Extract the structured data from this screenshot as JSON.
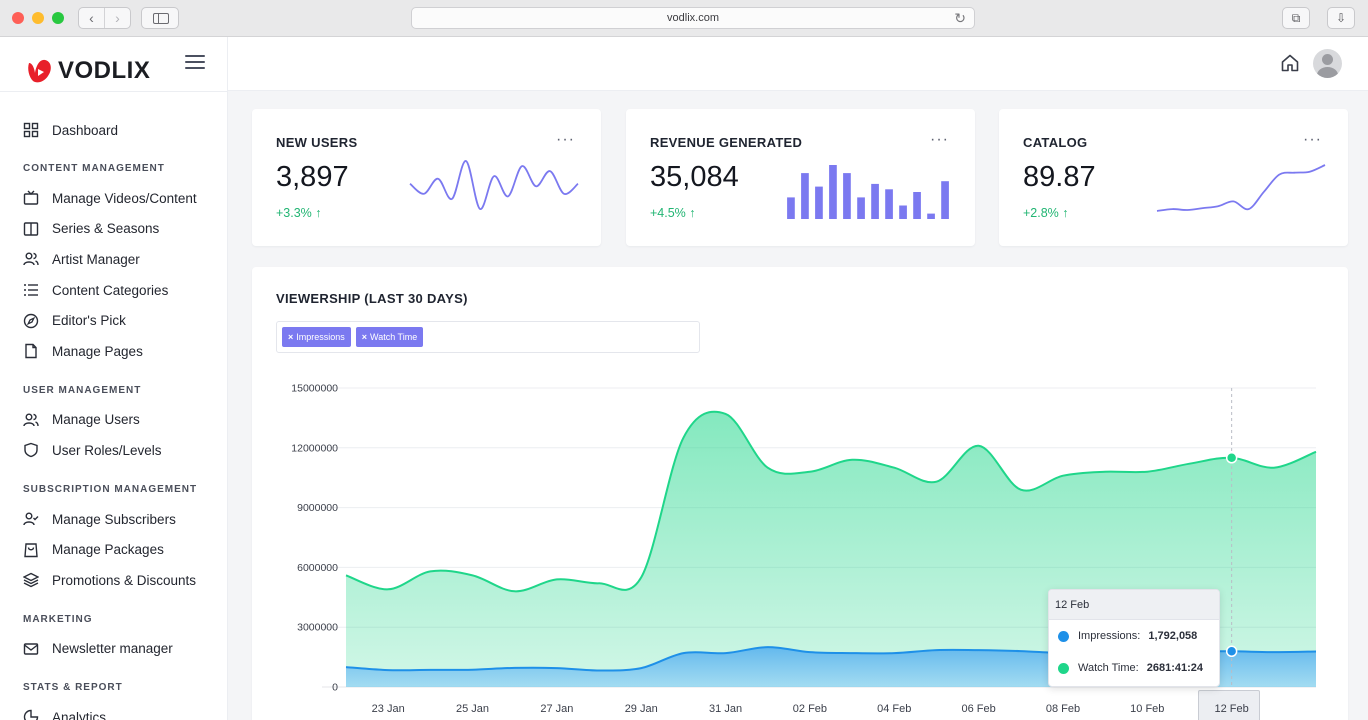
{
  "browser": {
    "url": "vodlix.com"
  },
  "brand": {
    "name": "VODLIX",
    "accent": "#e8202a"
  },
  "sidebar": {
    "dashboard": "Dashboard",
    "sections": [
      {
        "title": "CONTENT MANAGEMENT",
        "items": [
          "Manage Videos/Content",
          "Series & Seasons",
          "Artist Manager",
          "Content Categories",
          "Editor's Pick",
          "Manage Pages"
        ]
      },
      {
        "title": "USER MANAGEMENT",
        "items": [
          "Manage Users",
          "User Roles/Levels"
        ]
      },
      {
        "title": "SUBSCRIPTION MANAGEMENT",
        "items": [
          "Manage Subscribers",
          "Manage Packages",
          "Promotions & Discounts"
        ]
      },
      {
        "title": "MARKETING",
        "items": [
          "Newsletter manager"
        ]
      },
      {
        "title": "STATS & REPORT",
        "items": [
          "Analytics"
        ]
      }
    ]
  },
  "stats": [
    {
      "title": "NEW USERS",
      "value": "3,897",
      "change": "+3.3% ↑",
      "spark_type": "line",
      "spark": [
        30,
        22,
        34,
        18,
        48,
        10,
        36,
        20,
        44,
        28,
        40,
        22,
        30
      ]
    },
    {
      "title": "REVENUE GENERATED",
      "value": "35,084",
      "change": "+4.5% ↑",
      "spark_type": "bar",
      "spark": [
        4,
        8.5,
        6,
        10,
        8.5,
        4,
        6.5,
        5.5,
        2.5,
        5,
        1,
        7
      ]
    },
    {
      "title": "CATALOG",
      "value": "89.87",
      "change": "+2.8% ↑",
      "spark_type": "line",
      "spark": [
        10,
        12,
        11,
        13,
        15,
        20,
        12,
        30,
        48,
        50,
        51,
        58
      ]
    }
  ],
  "chart_card": {
    "title": "VIEWERSHIP (LAST 30 DAYS)",
    "filters": [
      "Impressions",
      "Watch Time"
    ]
  },
  "tooltip": {
    "date": "12 Feb",
    "rows": [
      {
        "label": "Impressions:",
        "value": "1,792,058"
      },
      {
        "label": "Watch Time:",
        "value": "2681:41:24"
      }
    ]
  },
  "chart_data": {
    "type": "area",
    "x": [
      "22 Jan",
      "23 Jan",
      "24 Jan",
      "25 Jan",
      "26 Jan",
      "27 Jan",
      "28 Jan",
      "29 Jan",
      "30 Jan",
      "31 Jan",
      "01 Feb",
      "02 Feb",
      "03 Feb",
      "04 Feb",
      "05 Feb",
      "06 Feb",
      "07 Feb",
      "08 Feb",
      "09 Feb",
      "10 Feb",
      "11 Feb",
      "12 Feb",
      "13 Feb",
      "14 Feb"
    ],
    "x_tick_labels": [
      "23 Jan",
      "25 Jan",
      "27 Jan",
      "29 Jan",
      "31 Jan",
      "02 Feb",
      "04 Feb",
      "06 Feb",
      "08 Feb",
      "10 Feb",
      "12 Feb"
    ],
    "y_ticks": [
      0,
      3000000,
      6000000,
      9000000,
      12000000,
      15000000
    ],
    "ylim": [
      0,
      15000000
    ],
    "series": [
      {
        "name": "Watch Time",
        "color": "#1fd68a",
        "values": [
          5600000,
          4900000,
          5800000,
          5600000,
          4800000,
          5400000,
          5200000,
          5500000,
          12500000,
          13700000,
          11000000,
          10800000,
          11400000,
          11000000,
          10300000,
          12100000,
          9900000,
          10600000,
          10800000,
          10800000,
          11200000,
          11500000,
          11000000,
          11800000
        ]
      },
      {
        "name": "Impressions",
        "color": "#1e90e8",
        "values": [
          1000000,
          850000,
          860000,
          870000,
          960000,
          950000,
          830000,
          950000,
          1700000,
          1700000,
          2000000,
          1750000,
          1700000,
          1700000,
          1850000,
          1850000,
          1800000,
          1700000,
          1700000,
          1700000,
          1780000,
          1792058,
          1750000,
          1780000
        ]
      }
    ],
    "highlight_index": 21
  }
}
